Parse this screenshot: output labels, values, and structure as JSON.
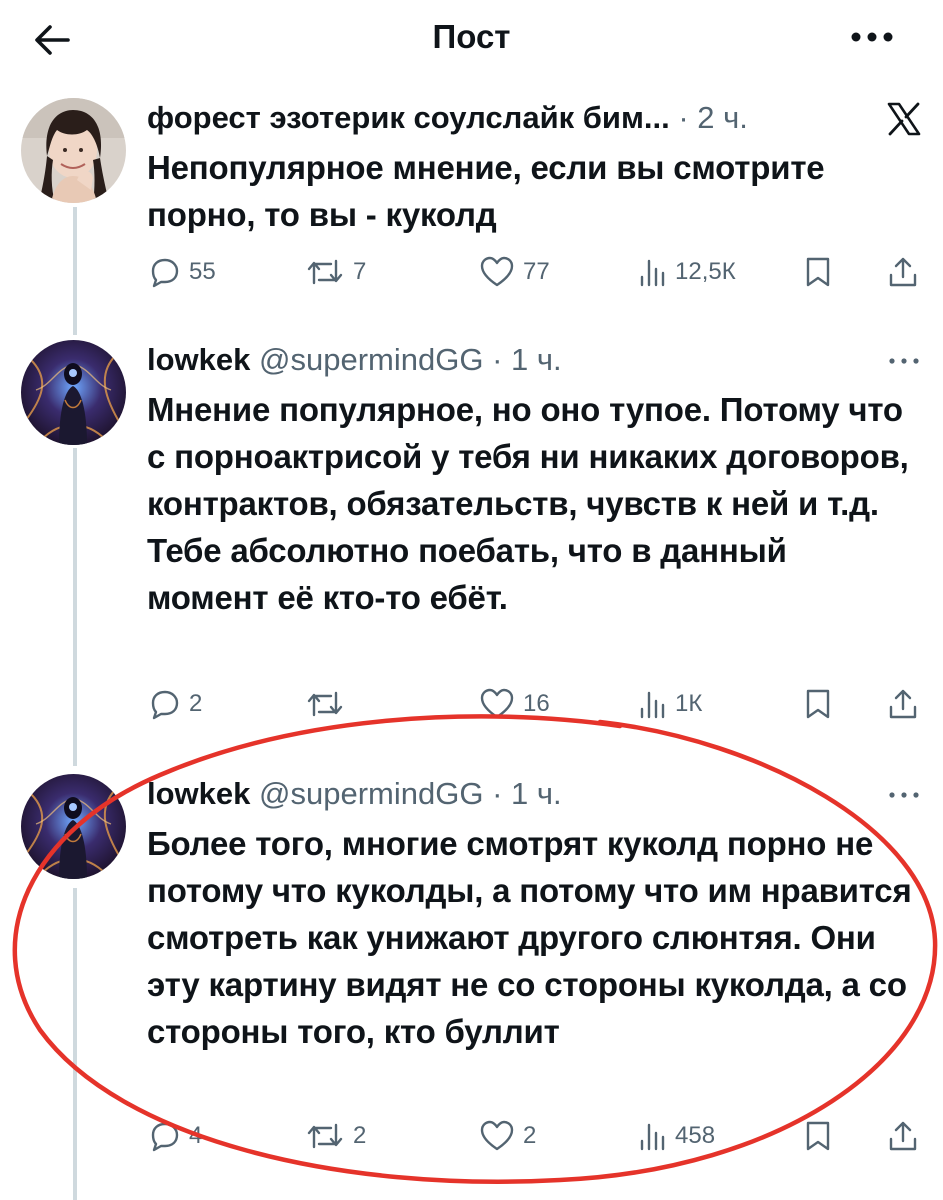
{
  "header": {
    "title": "Пост"
  },
  "tweets": [
    {
      "name": "форест эзотерик соулслайк бим...",
      "handle": "",
      "time": "2 ч.",
      "text": "Непопулярное мнение, если вы смотрите порно, то вы - куколд",
      "replies": "55",
      "reposts": "7",
      "likes": "77",
      "views": "12,5К"
    },
    {
      "name": "lowkek",
      "handle": "@supermindGG",
      "time": "1 ч.",
      "text": "Мнение популярное, но оно тупое. Потому что с порноактрисой у тебя ни никаких договоров, контрактов, обязательств, чувств к ней и т.д. Тебе абсолютно поебать, что в данный момент её кто-то ебёт.",
      "replies": "2",
      "reposts": "",
      "likes": "16",
      "views": "1К"
    },
    {
      "name": "lowkek",
      "handle": "@supermindGG",
      "time": "1 ч.",
      "text": "Более того, многие смотрят куколд порно не потому что куколды, а потому что им нравится смотреть как унижают другого слюнтяя. Они эту картину видят не со стороны куколда, а со стороны того, кто буллит",
      "replies": "4",
      "reposts": "2",
      "likes": "2",
      "views": "458"
    }
  ],
  "icons": {
    "back": "arrow-left-icon",
    "more": "more-horizontal-icon",
    "x_logo": "x-logo-icon",
    "reply": "reply-icon",
    "repost": "repost-icon",
    "like": "heart-icon",
    "views": "views-icon",
    "bookmark": "bookmark-icon",
    "share": "share-icon"
  },
  "colors": {
    "text": "#0f1419",
    "secondary": "#536471",
    "thread_line": "#cfd9de",
    "annotation": "#e5332a"
  }
}
